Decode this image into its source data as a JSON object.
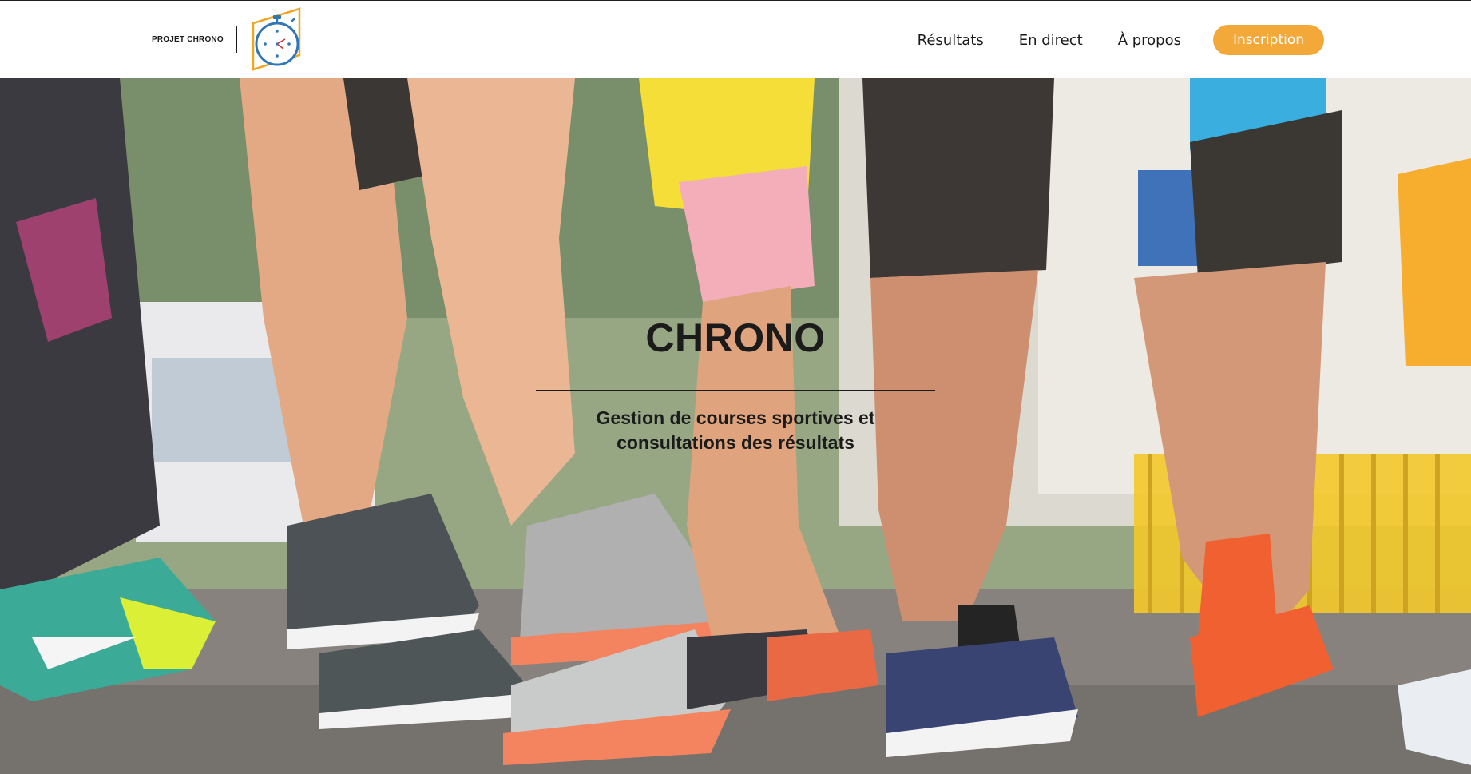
{
  "header": {
    "logo_text": "PROJET CHRONO",
    "logo_mark_icon": "stopwatch-icon",
    "nav": {
      "items": [
        {
          "label": "Résultats"
        },
        {
          "label": "En direct"
        },
        {
          "label": "À propos"
        }
      ],
      "cta_label": "Inscription"
    }
  },
  "hero": {
    "background_image": "runners-race-photo",
    "title": "CHRONO",
    "subtitle": "Gestion de courses sportives et consultations des résultats"
  },
  "colors": {
    "accent": "#f3a93a",
    "logo_blue": "#2f77b6",
    "logo_orange": "#f0a623",
    "text_dark": "#1b1b1b",
    "background": "#ffffff"
  }
}
